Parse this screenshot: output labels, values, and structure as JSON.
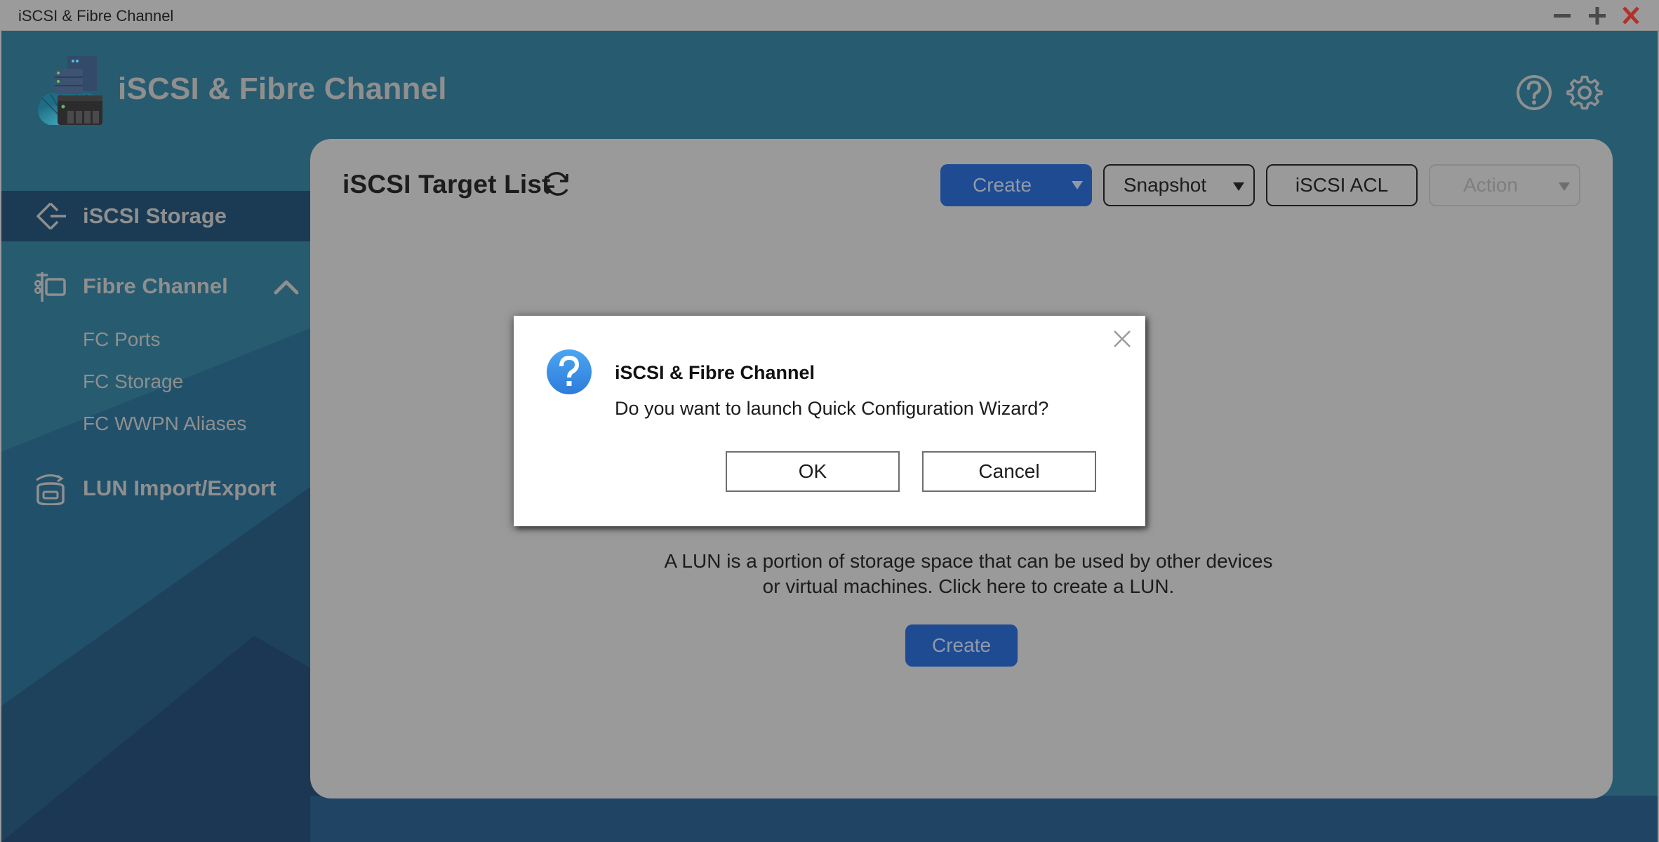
{
  "window": {
    "title": "iSCSI & Fibre Channel",
    "controls": {
      "minimize": "minimize",
      "maximize": "maximize",
      "close": "close"
    }
  },
  "header": {
    "app_title": "iSCSI & Fibre Channel",
    "icons": [
      "help-icon",
      "gear-icon"
    ]
  },
  "sidebar": {
    "items": [
      {
        "label": "iSCSI Storage",
        "icon": "iscsi-storage-icon",
        "active": true
      },
      {
        "label": "Fibre Channel",
        "icon": "fibre-channel-icon",
        "expanded": true,
        "children": [
          {
            "label": "FC Ports"
          },
          {
            "label": "FC Storage"
          },
          {
            "label": "FC WWPN Aliases"
          }
        ]
      },
      {
        "label": "LUN Import/Export",
        "icon": "lun-import-export-icon"
      }
    ]
  },
  "main": {
    "title": "iSCSI Target List",
    "toolbar": {
      "create": "Create",
      "snapshot": "Snapshot",
      "acl": "iSCSI ACL",
      "action": "Action"
    },
    "empty_state": {
      "line1": "A LUN is a portion of storage space that can be used by other devices",
      "line2": "or virtual machines. Click here to create a LUN.",
      "create": "Create"
    }
  },
  "dialog": {
    "title": "iSCSI & Fibre Channel",
    "message": "Do you want to launch Quick Configuration Wizard?",
    "ok": "OK",
    "cancel": "Cancel"
  },
  "colors": {
    "header_bg": "#275b70",
    "sidebar_active": "#1a3b53",
    "primary_button": "#1f4b93",
    "dialog_icon": "#3a8fe6",
    "close_red": "#b3312a"
  }
}
